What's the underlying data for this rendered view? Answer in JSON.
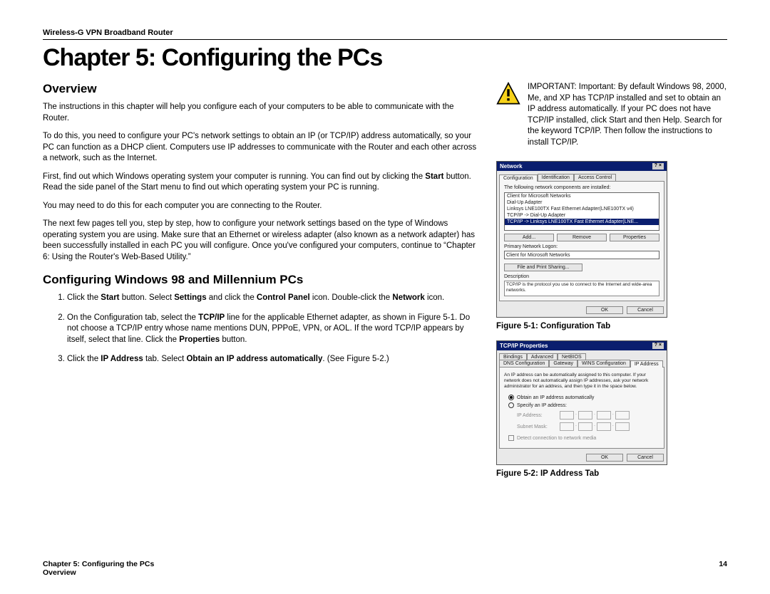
{
  "header": {
    "product": "Wireless-G VPN Broadband Router"
  },
  "chapter_title": "Chapter 5: Configuring the PCs",
  "overview": {
    "heading": "Overview",
    "p1": "The instructions in this chapter will help you configure each of your computers to be able to communicate with the Router.",
    "p2": "To do this, you need to configure your PC's network settings to obtain an IP (or TCP/IP) address automatically, so your PC can function as a DHCP client. Computers use IP addresses to communicate with the Router and each other across a network, such as the Internet.",
    "p3a": "First, find out which Windows operating system your computer is running. You can find out by clicking the ",
    "p3b_bold": "Start",
    "p3c": " button. Read the side panel of the Start menu to find out which operating system your PC is running.",
    "p4": "You may need to do this for each computer you are connecting to the Router.",
    "p5": "The next few pages tell you, step by step, how to configure your network settings based on the type of Windows operating system you are using. Make sure that an Ethernet or wireless adapter (also known as a network adapter) has been successfully installed in each PC you will configure. Once you've configured your computers, continue to “Chapter 6: Using the Router's Web-Based Utility.”"
  },
  "config98": {
    "heading": "Configuring Windows 98 and Millennium PCs",
    "step1": {
      "a": "Click the ",
      "b1": "Start",
      "c": " button. Select ",
      "b2": "Settings",
      "d": " and click the ",
      "b3": "Control Panel",
      "e": " icon. Double-click the ",
      "b4": "Network",
      "f": " icon."
    },
    "step2": {
      "a": "On the Configuration tab, select the ",
      "b1": "TCP/IP",
      "c": " line for the applicable Ethernet adapter, as shown in Figure 5-1. Do not choose a TCP/IP entry whose name mentions DUN, PPPoE, VPN, or AOL. If the word TCP/IP appears by itself, select that line. Click the ",
      "b2": "Properties",
      "d": " button."
    },
    "step3": {
      "a": "Click the ",
      "b1": "IP Address",
      "c": " tab. Select ",
      "b2": "Obtain an IP address automatically",
      "d": ". (See Figure 5-2.)"
    }
  },
  "important": {
    "label": "IMPORTANT:",
    "text": " Important: By default Windows 98, 2000, Me, and XP has TCP/IP installed and set to obtain an IP address automatically. If your PC does not have TCP/IP installed, click Start and then Help. Search for the keyword TCP/IP. Then follow the instructions to install TCP/IP."
  },
  "fig1": {
    "caption": "Figure 5-1: Configuration Tab",
    "title": "Network",
    "tabs": [
      "Configuration",
      "Identification",
      "Access Control"
    ],
    "listlabel": "The following network components are installed:",
    "items": [
      "Client for Microsoft Networks",
      "Dial-Up Adapter",
      "Linksys LNE100TX Fast Ethernet Adapter(LNE100TX v4)",
      "TCP/IP -> Dial-Up Adapter",
      "TCP/IP -> Linksys LNE100TX Fast Ethernet Adapter(LNE..."
    ],
    "btn_add": "Add...",
    "btn_remove": "Remove",
    "btn_props": "Properties",
    "logon_label": "Primary Network Logon:",
    "logon_value": "Client for Microsoft Networks",
    "btn_fileprint": "File and Print Sharing...",
    "desc_label": "Description",
    "desc_text": "TCP/IP is the protocol you use to connect to the Internet and wide-area networks.",
    "ok": "OK",
    "cancel": "Cancel"
  },
  "fig2": {
    "caption": "Figure 5-2: IP Address Tab",
    "title": "TCP/IP Properties",
    "tabs_top": [
      "Bindings",
      "Advanced",
      "NetBIOS"
    ],
    "tabs_bot": [
      "DNS Configuration",
      "Gateway",
      "WINS Configuration",
      "IP Address"
    ],
    "advisory": "An IP address can be automatically assigned to this computer. If your network does not automatically assign IP addresses, ask your network administrator for an address, and then type it in the space below.",
    "radio_auto": "Obtain an IP address automatically",
    "radio_specify": "Specify an IP address:",
    "ip_label": "IP Address:",
    "mask_label": "Subnet Mask:",
    "detect": "Detect connection to network media",
    "ok": "OK",
    "cancel": "Cancel"
  },
  "footer": {
    "line1": "Chapter 5: Configuring the PCs",
    "line2": "Overview",
    "page": "14"
  }
}
